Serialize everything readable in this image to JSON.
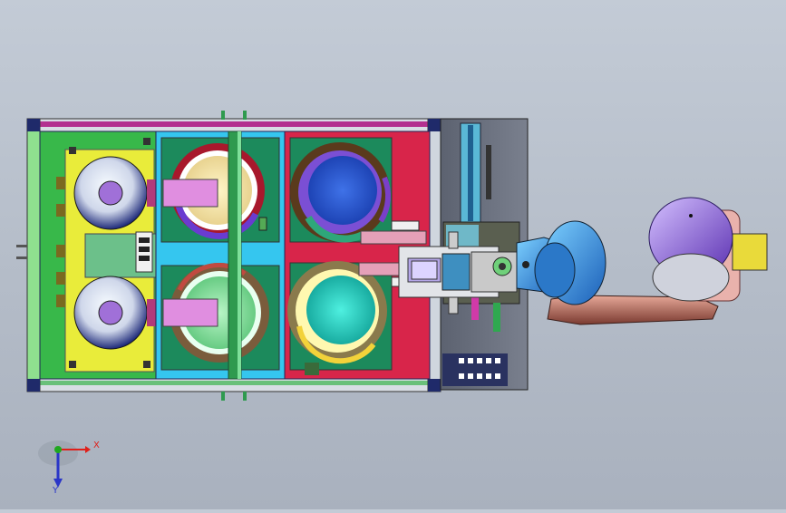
{
  "view": {
    "background_top": "#c3cbd6",
    "background_bottom": "#a9b1be"
  },
  "triad": {
    "x_label": "X",
    "y_label": "Y",
    "x_color": "#e0201a",
    "y_color": "#2a36c8",
    "z_color": "#1fa81f"
  },
  "colors": {
    "frame": "#6fd06f",
    "yellow_module": "#eded35",
    "cyan_module": "#3ac8ee",
    "green_module": "#2fb04f",
    "red_module": "#d42a4a",
    "purple_rail": "#b0308c",
    "gray_panel": "#6c7280",
    "robot_blue": "#3aa0e6",
    "robot_purple": "#8d6cd6",
    "robot_copper": "#c87a6a"
  }
}
